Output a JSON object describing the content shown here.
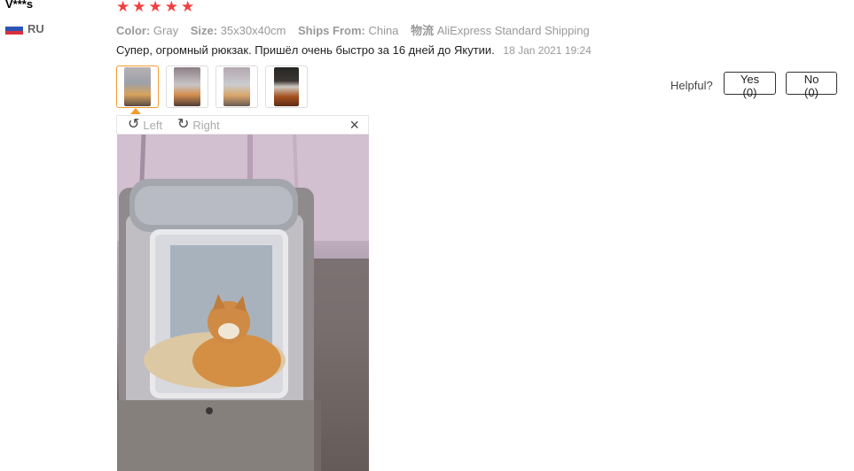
{
  "reviewer": {
    "name": "V***s",
    "country": "RU",
    "rating": 5
  },
  "meta": [
    {
      "key": "Color:",
      "value": "Gray"
    },
    {
      "key": "Size:",
      "value": "35x30x40cm"
    },
    {
      "key": "Ships From:",
      "value": "China"
    },
    {
      "key": "物流",
      "value": "AliExpress Standard Shipping"
    }
  ],
  "review": {
    "text": "Супер, огромный рюкзак. Пришёл очень быстро за 16 дней до Якутии.",
    "date": "18 Jan 2021 19:24"
  },
  "helpful": {
    "label": "Helpful?",
    "yes": "Yes (0)",
    "no": "No (0)"
  },
  "viewer": {
    "rotate_left": "Left",
    "rotate_right": "Right",
    "close": "×"
  },
  "icons": {
    "star": "★",
    "rotate_left": "↺",
    "rotate_right": "↻"
  },
  "colors": {
    "star": "#f0403f",
    "active_thumb": "#f39b2e"
  }
}
